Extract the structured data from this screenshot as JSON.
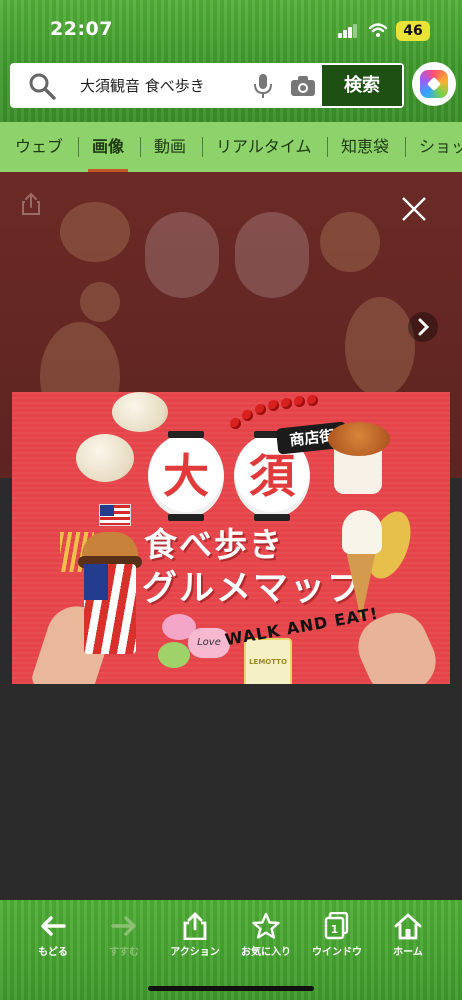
{
  "status_bar": {
    "time": "22:07",
    "battery": "46"
  },
  "search": {
    "query": "大須観音 食べ歩き",
    "submit_label": "検索"
  },
  "tabs": [
    {
      "label": "ウェブ"
    },
    {
      "label": "画像",
      "selected": true
    },
    {
      "label": "動画"
    },
    {
      "label": "リアルタイム"
    },
    {
      "label": "知恵袋"
    },
    {
      "label": "ショッ"
    }
  ],
  "image": {
    "lantern_left": "大",
    "lantern_right": "須",
    "tag": "商店街",
    "title_line1": "食べ歩き",
    "title_line2": "グルメマップ",
    "tagline": "WALK AND EAT!",
    "love_label": "Love",
    "lemon_label": "LEMOTTO"
  },
  "toolbar": {
    "back": "もどる",
    "forward": "すすむ",
    "action": "アクション",
    "favorites": "お気に入り",
    "windows": "ウインドウ",
    "windows_count": "1",
    "home": "ホーム"
  },
  "colors": {
    "grass": "#46a332",
    "tab_bg": "#8ed26b",
    "search_button": "#1e4f13",
    "poster_red": "#e5454a",
    "viewer_bg": "#2b2b2b"
  },
  "icons": [
    "search-icon",
    "mic-icon",
    "camera-icon",
    "assistant-icon",
    "share-icon",
    "close-icon",
    "chevron-right-icon",
    "arrow-left-icon",
    "arrow-right-icon",
    "share-up-icon",
    "star-icon",
    "windows-icon",
    "home-icon"
  ]
}
